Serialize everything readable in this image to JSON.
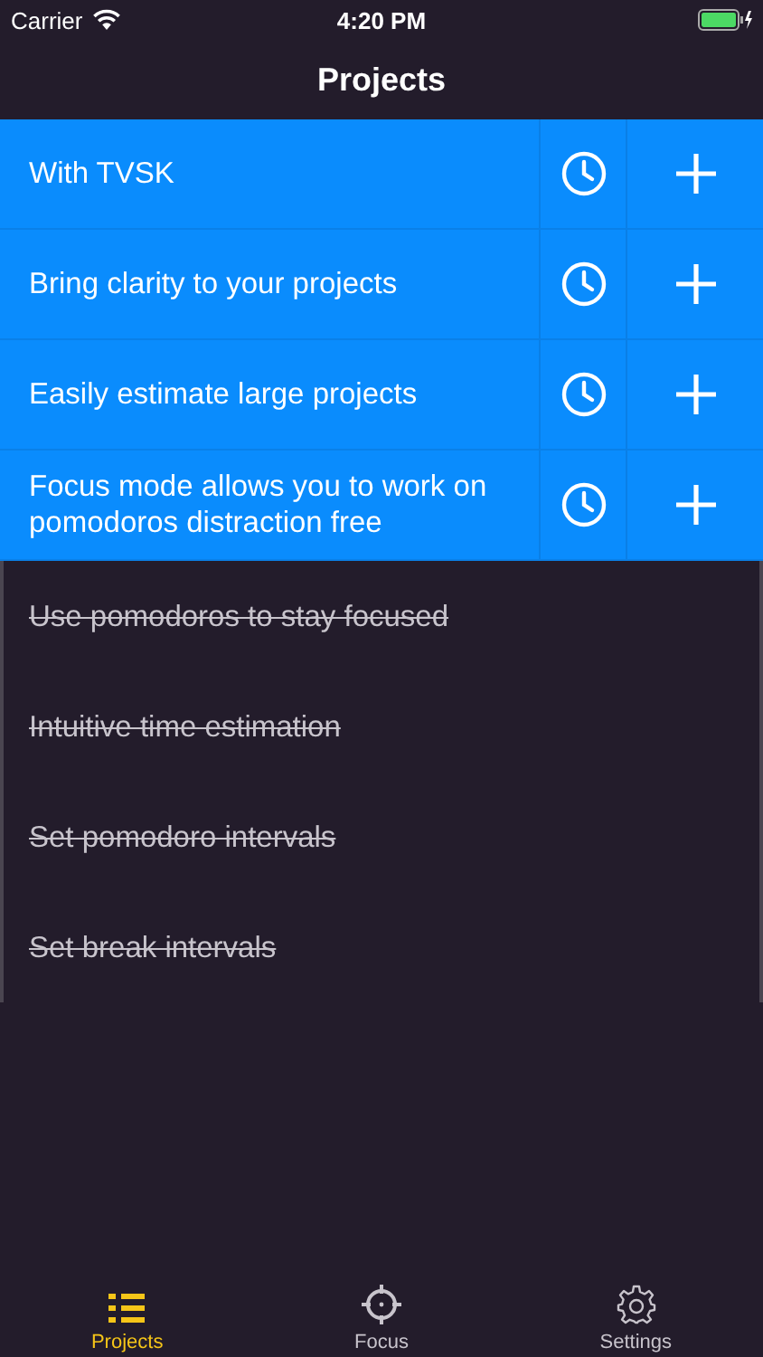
{
  "status_bar": {
    "carrier": "Carrier",
    "time": "4:20 PM"
  },
  "title": "Projects",
  "items": [
    {
      "text": "With TVSK",
      "done": false
    },
    {
      "text": "Bring clarity to your projects",
      "done": false
    },
    {
      "text": "Easily estimate large projects",
      "done": false
    },
    {
      "text": "Focus mode allows you to work on pomodoros distraction free",
      "done": false
    },
    {
      "text": "Use pomodoros to stay focused",
      "done": true
    },
    {
      "text": "Intuitive time estimation",
      "done": true
    },
    {
      "text": "Set pomodoro intervals",
      "done": true
    },
    {
      "text": "Set break intervals",
      "done": true
    }
  ],
  "tabs": [
    {
      "label": "Projects",
      "kind": "list",
      "selected": true
    },
    {
      "label": "Focus",
      "kind": "target",
      "selected": false
    },
    {
      "label": "Settings",
      "kind": "gear",
      "selected": false
    }
  ]
}
